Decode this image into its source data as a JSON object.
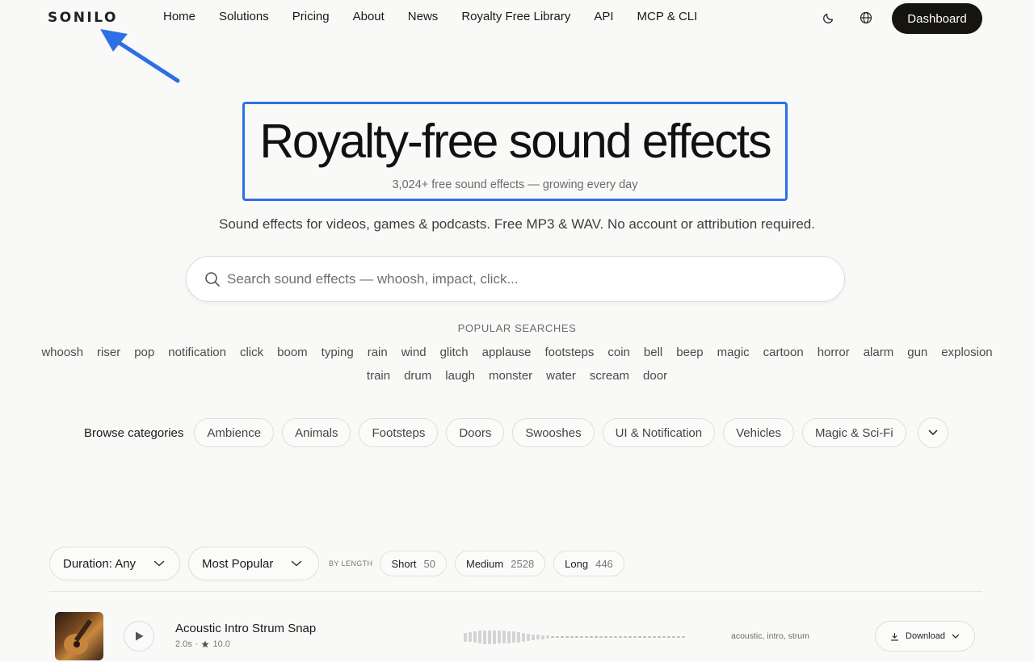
{
  "brand": {
    "logo": "SONILO"
  },
  "nav": [
    "Home",
    "Solutions",
    "Pricing",
    "About",
    "News",
    "Royalty Free Library",
    "API",
    "MCP & CLI"
  ],
  "header": {
    "dashboard_label": "Dashboard",
    "theme_icon": "moon-icon",
    "language_icon": "globe-icon"
  },
  "hero": {
    "title": "Royalty-free sound effects",
    "subtitle": "3,024+ free sound effects — growing every day",
    "tagline": "Sound effects for videos, games & podcasts. Free MP3 & WAV. No account or attribution required.",
    "highlight_color": "#2f6fe6"
  },
  "search": {
    "placeholder": "Search sound effects — whoosh, impact, click...",
    "value": ""
  },
  "popular": {
    "label": "POPULAR SEARCHES",
    "tags": [
      "whoosh",
      "riser",
      "pop",
      "notification",
      "click",
      "boom",
      "typing",
      "rain",
      "wind",
      "glitch",
      "applause",
      "footsteps",
      "coin",
      "bell",
      "beep",
      "magic",
      "cartoon",
      "horror",
      "alarm",
      "gun",
      "explosion",
      "train",
      "drum",
      "laugh",
      "monster",
      "water",
      "scream",
      "door"
    ]
  },
  "categories": {
    "label": "Browse categories",
    "items": [
      "Ambience",
      "Animals",
      "Footsteps",
      "Doors",
      "Swooshes",
      "UI & Notification",
      "Vehicles",
      "Magic & Sci-Fi"
    ]
  },
  "filters": {
    "duration": "Duration: Any",
    "sort": "Most Popular",
    "by_length_label": "BY LENGTH",
    "lengths": [
      {
        "label": "Short",
        "count": "50"
      },
      {
        "label": "Medium",
        "count": "2528"
      },
      {
        "label": "Long",
        "count": "446"
      }
    ]
  },
  "tracks": [
    {
      "title": "Acoustic Intro Strum Snap",
      "duration": "2.0s",
      "separator": "·",
      "rating": "10.0",
      "tags": "acoustic, intro, strum",
      "download_label": "Download",
      "waveform": [
        0.55,
        0.6,
        0.7,
        0.8,
        0.85,
        0.85,
        0.85,
        0.8,
        0.8,
        0.75,
        0.7,
        0.65,
        0.55,
        0.45,
        0.35,
        0.3,
        0.25,
        0.22,
        0.2,
        0.18,
        0.16,
        0.15,
        0.15,
        0.15,
        0.15,
        0.15,
        0.15,
        0.15,
        0.15,
        0.15,
        0.15,
        0.15,
        0.15,
        0.15,
        0.15,
        0.15,
        0.15,
        0.15,
        0.15,
        0.15,
        0.15,
        0.15,
        0.15,
        0.15,
        0.15,
        0.15
      ]
    }
  ]
}
